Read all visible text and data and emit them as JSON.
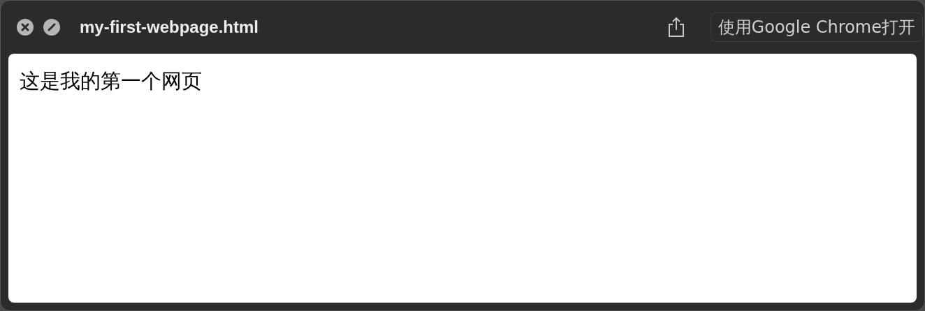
{
  "window": {
    "title": "my-first-webpage.html"
  },
  "toolbar": {
    "open_button": "使用Google Chrome打开"
  },
  "page": {
    "text": "这是我的第一个网页"
  }
}
